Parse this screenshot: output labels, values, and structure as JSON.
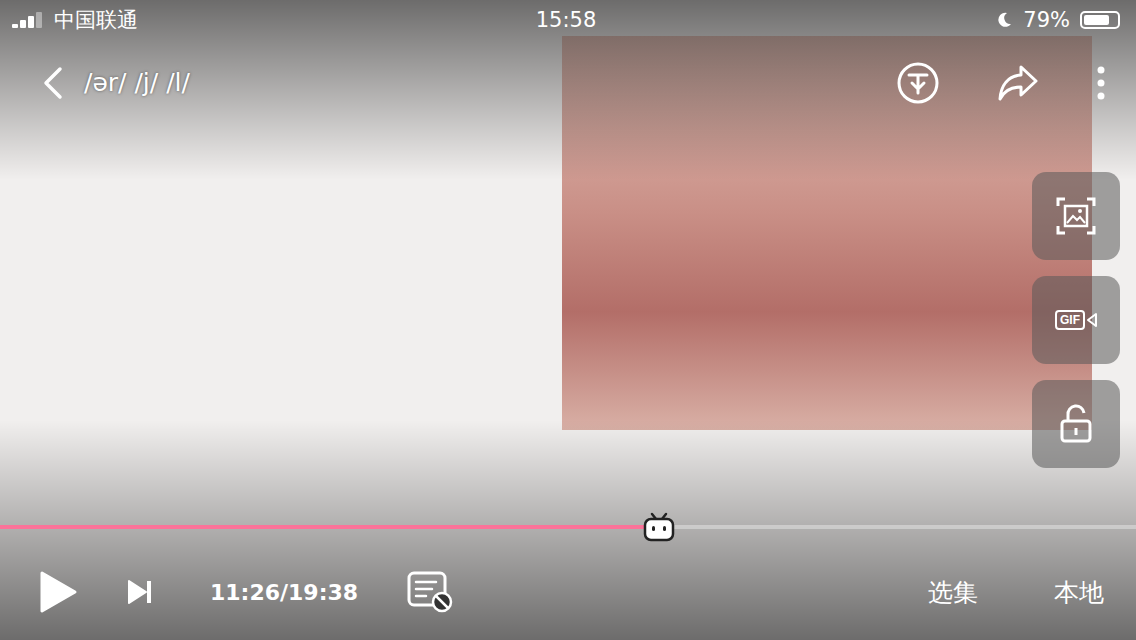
{
  "status_bar": {
    "carrier": "中国联通",
    "time": "15:58",
    "battery": "79%",
    "battery_level": 0.79,
    "do_not_disturb": true
  },
  "player": {
    "title": "/ər/ /j/ /l/",
    "paused": true,
    "progress": {
      "level": 0.58
    },
    "time": "11:26/19:38",
    "danmaku_on": false,
    "gif_label": "GIF",
    "locked": false,
    "buttons": [
      {
        "label": "选集"
      },
      {
        "label": "本地"
      }
    ]
  }
}
